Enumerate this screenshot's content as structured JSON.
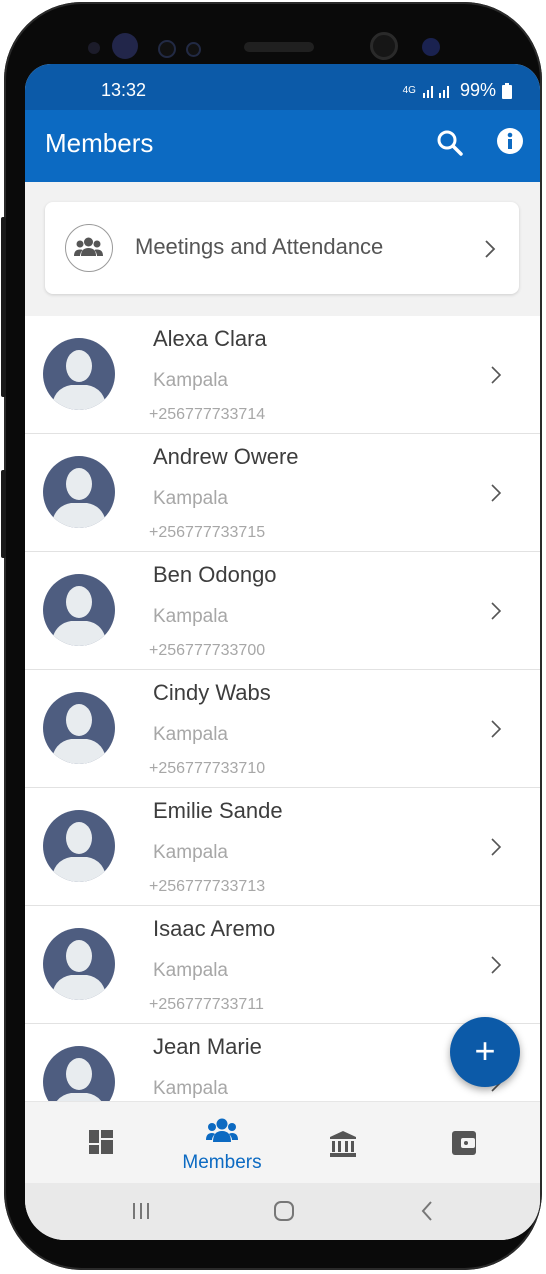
{
  "status_bar": {
    "time": "13:32",
    "network": "4G",
    "battery": "99%"
  },
  "app_bar": {
    "title": "Members"
  },
  "meetings_card": {
    "label": "Meetings and Attendance"
  },
  "members": [
    {
      "name": "Alexa Clara",
      "city": "Kampala",
      "phone": "+256777733714"
    },
    {
      "name": "Andrew Owere",
      "city": "Kampala",
      "phone": "+256777733715"
    },
    {
      "name": "Ben Odongo",
      "city": "Kampala",
      "phone": "+256777733700"
    },
    {
      "name": "Cindy Wabs",
      "city": "Kampala",
      "phone": "+256777733710"
    },
    {
      "name": "Emilie Sande",
      "city": "Kampala",
      "phone": "+256777733713"
    },
    {
      "name": "Isaac Aremo",
      "city": "Kampala",
      "phone": "+256777733711"
    },
    {
      "name": "Jean Marie",
      "city": "Kampala",
      "phone": ""
    }
  ],
  "fab": {
    "label": "+"
  },
  "bottom_nav": {
    "active_label": "Members",
    "items": [
      "dashboard-icon",
      "members-icon",
      "bank-icon",
      "wallet-icon"
    ]
  },
  "colors": {
    "primary": "#0c6ac2",
    "status_bar": "#0c5aa8",
    "avatar": "#4e5d80"
  }
}
